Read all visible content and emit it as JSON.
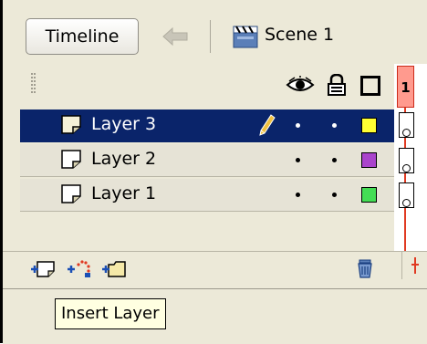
{
  "toolbar": {
    "timeline_label": "Timeline",
    "scene_label": "Scene 1"
  },
  "header": {
    "frame_number": "1"
  },
  "layers": [
    {
      "name": "Layer 3",
      "selected": true,
      "color": "#ffff33"
    },
    {
      "name": "Layer 2",
      "selected": false,
      "color": "#aa44cc"
    },
    {
      "name": "Layer 1",
      "selected": false,
      "color": "#44dd55"
    }
  ],
  "tooltip": {
    "text": "Insert Layer"
  },
  "colors": {
    "selection": "#0a246a",
    "panel": "#ece9d8",
    "playhead": "#e03a22"
  }
}
